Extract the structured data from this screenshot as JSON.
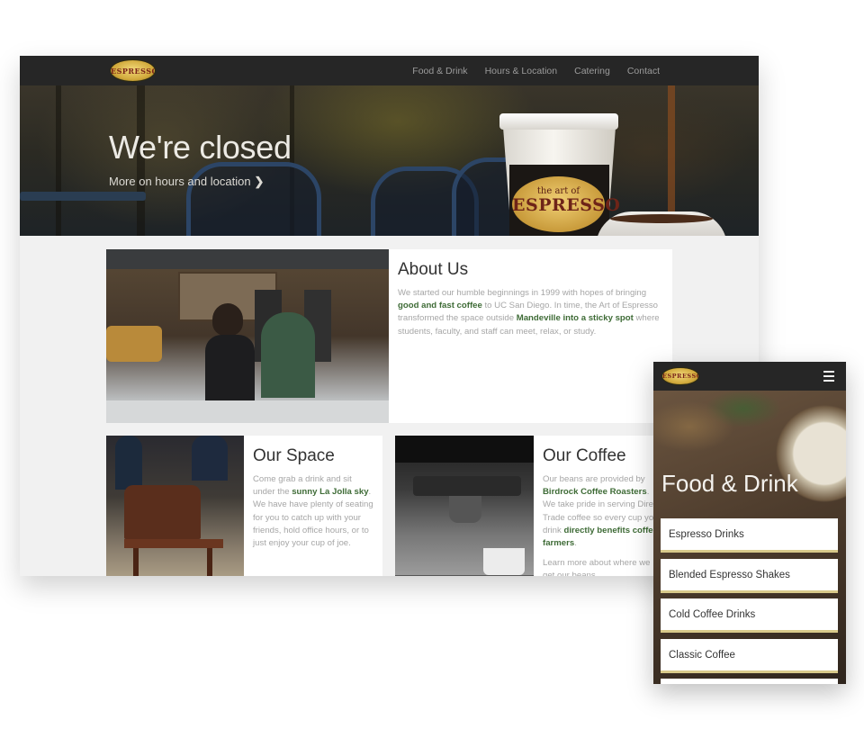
{
  "colors": {
    "nav_bg": "#262626",
    "accent_green": "#3e6b36",
    "body_text": "#a6a6a6",
    "menu_underline": "#d8c98a"
  },
  "desktop": {
    "logo_text": "ESPRESSO",
    "nav": {
      "items": [
        "Food & Drink",
        "Hours & Location",
        "Catering",
        "Contact"
      ]
    },
    "hero": {
      "title": "We're closed",
      "link_text": "More on hours and location",
      "link_icon": "chevron-right-icon",
      "cup_logo_small": "the art of",
      "cup_logo_main": "ESPRESSO"
    },
    "about": {
      "title": "About Us",
      "body": [
        {
          "t": "We started our humble beginnings in 1999 with hopes of bringing ",
          "b": false
        },
        {
          "t": "good and fast coffee",
          "b": true
        },
        {
          "t": " to UC San Diego. In time, the Art of Espresso transformed the space outside ",
          "b": false
        },
        {
          "t": "Mandeville into a sticky spot",
          "b": true
        },
        {
          "t": " where students, faculty, and staff can meet, relax, or study.",
          "b": false
        }
      ]
    },
    "space": {
      "title": "Our Space",
      "body": [
        {
          "t": "Come grab a drink and sit under the ",
          "b": false
        },
        {
          "t": "sunny La Jolla sky",
          "b": true
        },
        {
          "t": ". We have have plenty of seating for you to catch up with your friends, hold office hours, or to just enjoy your cup of joe.",
          "b": false
        }
      ]
    },
    "coffee": {
      "title": "Our Coffee",
      "body": [
        {
          "t": "Our beans are provided by ",
          "b": false
        },
        {
          "t": "Birdrock Coffee Roasters",
          "b": true
        },
        {
          "t": ". We take pride in serving Direct Trade coffee so every cup you drink ",
          "b": false
        },
        {
          "t": "directly benefits coffee farmers",
          "b": true
        },
        {
          "t": ".",
          "b": false
        }
      ],
      "body2": "Learn more about where we get our beans."
    }
  },
  "mobile": {
    "logo_text": "ESPRESSO",
    "menu_icon": "hamburger-icon",
    "hero_title": "Food & Drink",
    "menu_items": [
      "Espresso Drinks",
      "Blended Espresso Shakes",
      "Cold Coffee Drinks",
      "Classic Coffee"
    ]
  }
}
